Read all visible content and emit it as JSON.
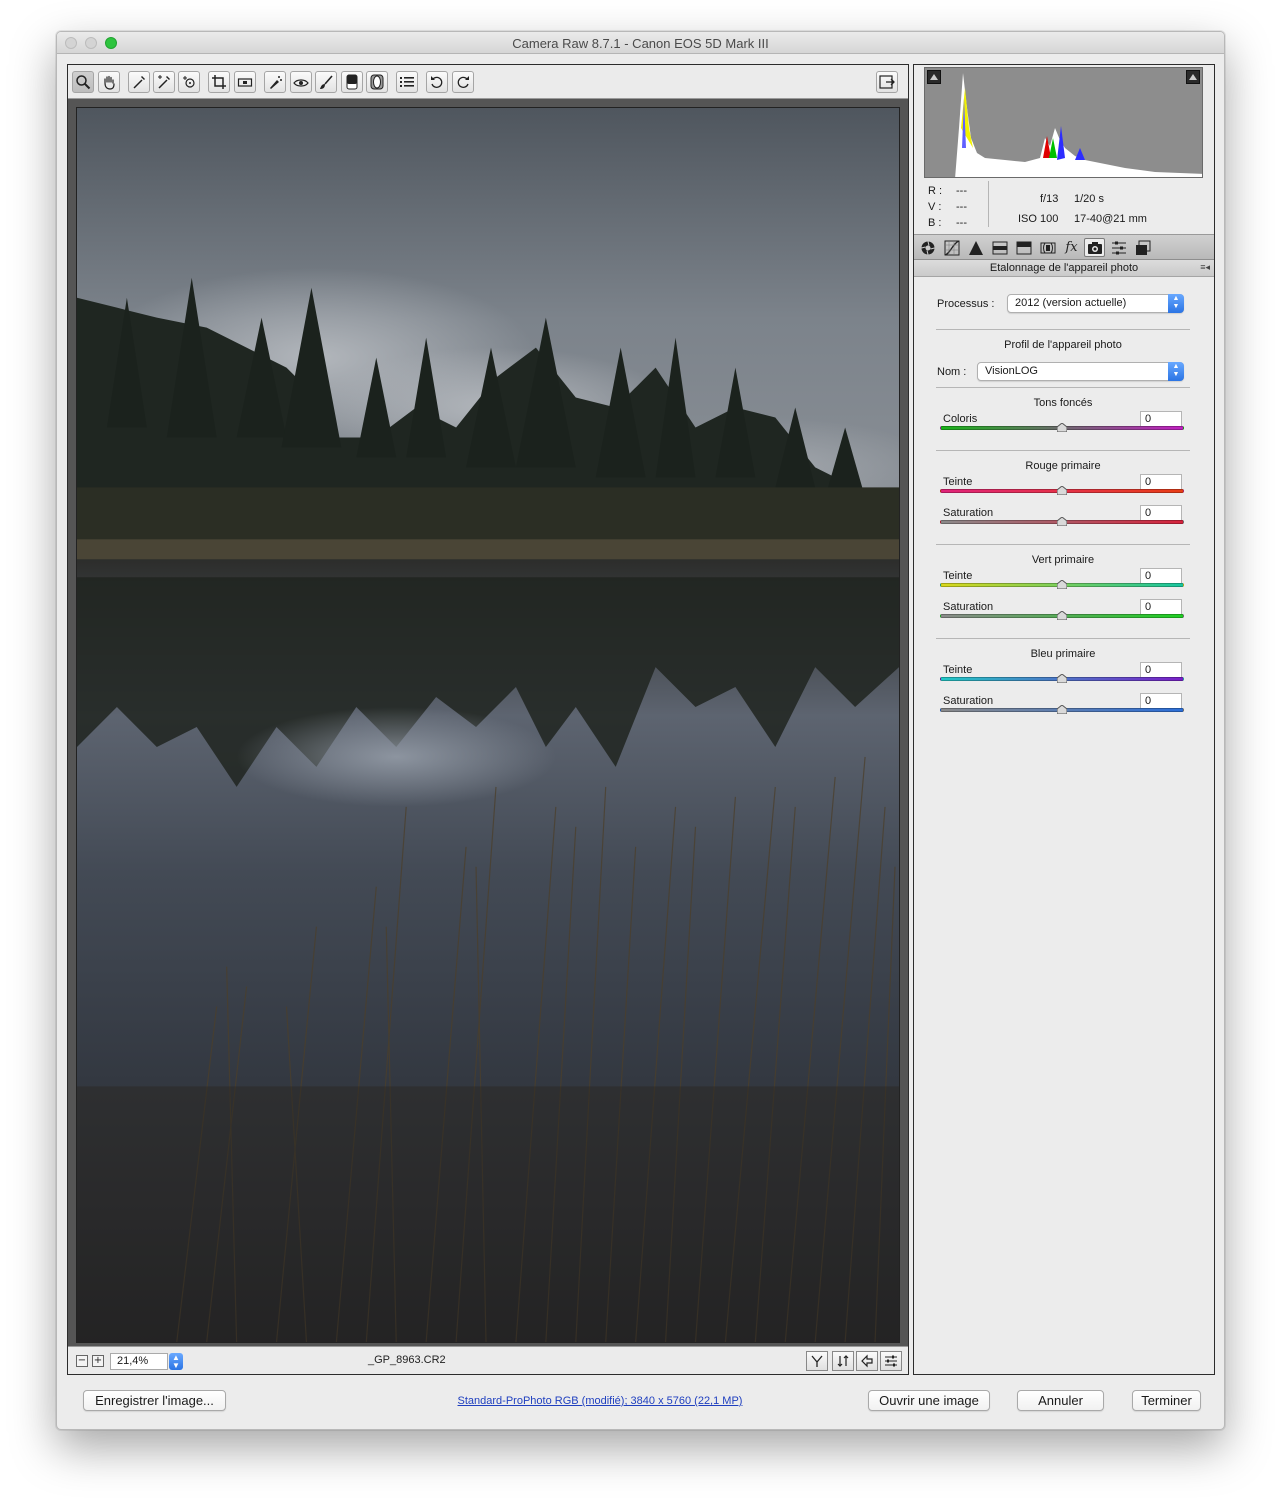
{
  "window": {
    "title": "Camera Raw 8.7.1  -  Canon EOS 5D Mark III"
  },
  "toolbar": {
    "tools": [
      {
        "name": "zoom-tool",
        "icon": "magnifier-icon"
      },
      {
        "name": "hand-tool",
        "icon": "hand-icon"
      },
      {
        "name": "white-balance-tool",
        "icon": "eyedropper-icon"
      },
      {
        "name": "color-sampler-tool",
        "icon": "color-sampler-icon"
      },
      {
        "name": "targeted-adjustment-tool",
        "icon": "target-adjust-icon"
      },
      {
        "name": "crop-tool",
        "icon": "crop-icon"
      },
      {
        "name": "straighten-tool",
        "icon": "level-icon"
      },
      {
        "name": "spot-removal-tool",
        "icon": "spot-removal-icon"
      },
      {
        "name": "red-eye-tool",
        "icon": "eye-icon"
      },
      {
        "name": "adjustment-brush-tool",
        "icon": "brush-icon"
      },
      {
        "name": "graduated-filter-tool",
        "icon": "graduated-filter-icon"
      },
      {
        "name": "radial-filter-tool",
        "icon": "radial-filter-icon"
      },
      {
        "name": "preferences-button",
        "icon": "list-icon"
      },
      {
        "name": "rotate-left-button",
        "icon": "rotate-ccw-icon"
      },
      {
        "name": "rotate-right-button",
        "icon": "rotate-cw-icon"
      }
    ],
    "fullscreen_icon": "fullscreen-icon"
  },
  "preview": {
    "zoom_out_label": "−",
    "zoom_in_label": "+",
    "zoom": "21,4%",
    "filename": "_GP_8963.CR2"
  },
  "info": {
    "r_label": "R :",
    "r_value": "---",
    "v_label": "V :",
    "v_value": "---",
    "b_label": "B :",
    "b_value": "---",
    "aperture": "f/13",
    "shutter": "1/20 s",
    "iso": "ISO 100",
    "lens": "17-40@21 mm"
  },
  "panel": {
    "title": "Etalonnage de l'appareil photo",
    "menu_icon": "panel-menu-icon",
    "process_label": "Processus :",
    "process_value": "2012 (version actuelle)",
    "profile_heading": "Profil de l'appareil photo",
    "name_label": "Nom :",
    "name_value": "VisionLOG",
    "sections": [
      {
        "title": "Tons foncés",
        "sliders": [
          {
            "label": "Coloris",
            "value": "0",
            "gradient": [
              "#19b319",
              "#c11fc1"
            ]
          }
        ]
      },
      {
        "title": "Rouge primaire",
        "sliders": [
          {
            "label": "Teinte",
            "value": "0",
            "gradient": [
              "#e0247a",
              "#e83d16"
            ]
          },
          {
            "label": "Saturation",
            "value": "0",
            "gradient": [
              "#8a8a8a",
              "#d6223c"
            ]
          }
        ]
      },
      {
        "title": "Vert primaire",
        "sliders": [
          {
            "label": "Teinte",
            "value": "0",
            "gradient": [
              "#d9d81b",
              "#17c6a0"
            ]
          },
          {
            "label": "Saturation",
            "value": "0",
            "gradient": [
              "#8a8a8a",
              "#1fcf23"
            ]
          }
        ]
      },
      {
        "title": "Bleu primaire",
        "sliders": [
          {
            "label": "Teinte",
            "value": "0",
            "gradient": [
              "#21c9c6",
              "#7a1fc8"
            ]
          },
          {
            "label": "Saturation",
            "value": "0",
            "gradient": [
              "#8a8a8a",
              "#2c6fd8"
            ]
          }
        ]
      }
    ]
  },
  "bottom": {
    "save_label": "Enregistrer l'image...",
    "workflow_link": "Standard-ProPhoto RGB (modifié); 3840 x 5760 (22,1 MP)",
    "open_label": "Ouvrir une image",
    "cancel_label": "Annuler",
    "done_label": "Terminer"
  },
  "colors": {
    "accent": "#2b74e4",
    "link": "#1f3fbf"
  }
}
